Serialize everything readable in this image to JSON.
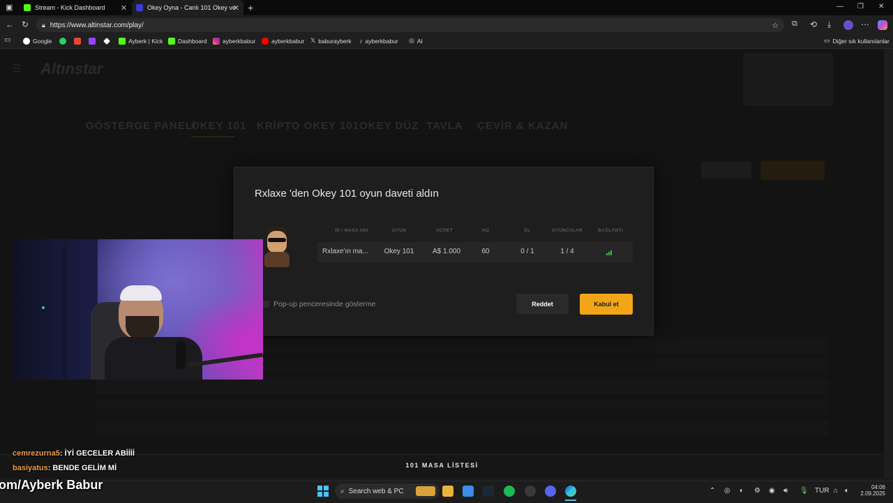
{
  "browser": {
    "tabs": [
      {
        "title": "Stream - Kick Dashboard"
      },
      {
        "title": "Okey Oyna - Canlı 101 Okey ve D"
      }
    ],
    "new_tab": "+",
    "url": "https://www.altinstar.com/play/",
    "bookmarks": [
      {
        "label": "Google"
      },
      {
        "label": "Ayberk | Kick"
      },
      {
        "label": "Dashboard"
      },
      {
        "label": "ayberkbabur"
      },
      {
        "label": "ayberkbabur"
      },
      {
        "label": "baburayberk"
      },
      {
        "label": "ayberkbabur"
      },
      {
        "label": "AI"
      }
    ],
    "other_bookmarks": "Diğer sık kullanılanlar"
  },
  "site": {
    "logo": "Altınstar",
    "nav": [
      "GÖSTERGE PANELİ",
      "OKEY 101",
      "KRİPTO OKEY 101",
      "OKEY DÜZ",
      "TAVLA",
      "ÇEVİR & KAZAN"
    ]
  },
  "modal": {
    "title": "Rxlaxe 'den Okey 101 oyun daveti aldın",
    "columns": [
      "ID / MASA ADI",
      "OYUN",
      "ÜCRET",
      "HIZ",
      "EL",
      "OYUNCULAR",
      "BAĞLANTI"
    ],
    "row": {
      "name": "Rxlaxe'ın ma...",
      "game": "Okey 101",
      "fee": "A$  1.000",
      "speed": "60",
      "hand": "0 / 1",
      "players": "1 / 4"
    },
    "popup_label": "Pop-up penceresinde gösterme",
    "reject_label": "Reddet",
    "accept_label": "Kabul et"
  },
  "footer": {
    "list_title": "101 MASA LİSTESİ"
  },
  "chat": [
    {
      "user": "cemrezurna5",
      "message": ": İYİ GECELER ABİİİİ"
    },
    {
      "user": "basiyatus",
      "message": ": BENDE GELİM Mİ"
    }
  ],
  "overlay": {
    "text": "om/Ayberk Babur"
  },
  "taskbar": {
    "search_label": "Search web & PC",
    "language": "TUR",
    "time": "04:06",
    "date": "2.09.2025"
  },
  "colors": {
    "accent": "#f2a516",
    "connection": "#3fbf3f"
  }
}
